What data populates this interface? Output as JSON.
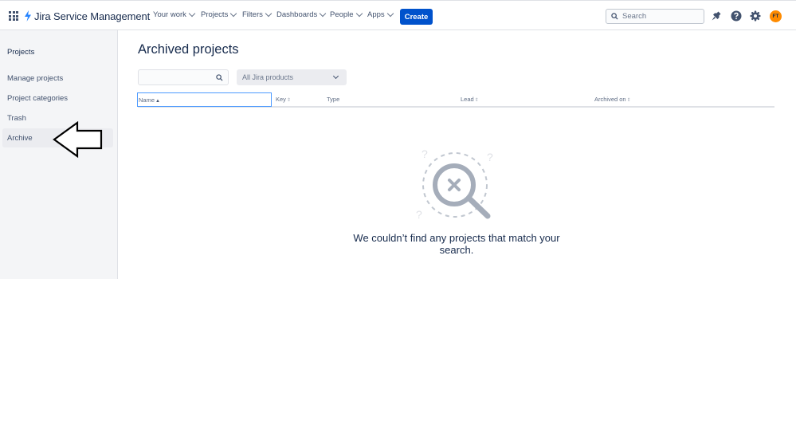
{
  "nav": {
    "product_name": "Jira Service Management",
    "items": [
      {
        "label": "Your work"
      },
      {
        "label": "Projects"
      },
      {
        "label": "Filters"
      },
      {
        "label": "Dashboards"
      },
      {
        "label": "People"
      },
      {
        "label": "Apps"
      }
    ],
    "create_label": "Create",
    "search_placeholder": "Search",
    "avatar_initials": "FT",
    "accent_color": "#0052cc"
  },
  "sidebar": {
    "heading": "Projects",
    "items": [
      {
        "label": "Manage projects"
      },
      {
        "label": "Project categories"
      },
      {
        "label": "Trash"
      },
      {
        "label": "Archive",
        "selected": true
      }
    ]
  },
  "main": {
    "title": "Archived projects",
    "search_value": "",
    "product_filter": "All Jira products",
    "columns": [
      {
        "label": "Name",
        "sort": "ascending"
      },
      {
        "label": "Key"
      },
      {
        "label": "Type"
      },
      {
        "label": "Lead"
      },
      {
        "label": "Archived on"
      }
    ],
    "empty_message": "We couldn’t find any projects that match your search."
  }
}
